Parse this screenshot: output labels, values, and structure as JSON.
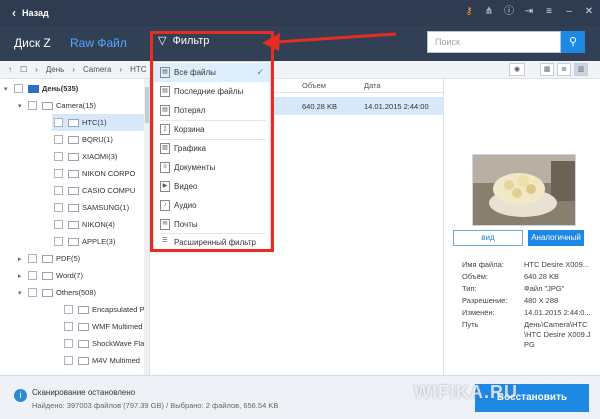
{
  "titlebar": {
    "back_label": "Назад"
  },
  "header": {
    "tabs": [
      {
        "label": "Диск Z"
      },
      {
        "label": "Raw Файл"
      }
    ],
    "filter_label": "Фильтр",
    "search_placeholder": "Поиск"
  },
  "breadcrumb": {
    "items": [
      "День",
      "Camera",
      "HTC"
    ]
  },
  "tree": {
    "root": "День(535)",
    "camera": "Camera(15)",
    "camera_children": [
      "HTC(1)",
      "BQRU(1)",
      "XIAOMI(3)",
      "NIKON CORPO",
      "CASIO COMPU",
      "SAMSUNG(1)",
      "NIKON(4)",
      "APPLE(3)"
    ],
    "pdf": "PDF(5)",
    "word": "Word(7)",
    "others": "Others(508)",
    "others_children": [
      "Encapsulated P",
      "WMF Multimed",
      "ShockWave Fla",
      "M4V Multimed"
    ]
  },
  "filter_menu": {
    "items": [
      "Все файлы",
      "Последние файлы",
      "Потерял",
      "Корзина",
      "Графика",
      "Документы",
      "Видео",
      "Аудио",
      "Почты",
      "Расширенный фильтр"
    ]
  },
  "file_list": {
    "columns": [
      "Объем",
      "Дата"
    ],
    "rows": [
      {
        "size": "640.28 KB",
        "date": "14.01.2015 2:44:00"
      }
    ]
  },
  "preview": {
    "buttons": {
      "view": "вид",
      "analog": "Аналогичный"
    },
    "labels": [
      "Имя файла:",
      "Объём:",
      "Тип:",
      "Разрешение:",
      "Изменён:",
      "Путь"
    ],
    "values": [
      "HTC Desire X009...",
      "640.28 KB",
      "Файл \"JPG\"",
      "480 X 288",
      "14.01.2015 2:44:0...",
      "День\\Camera\\HTC\\HTC Desire X009.JPG"
    ]
  },
  "status": {
    "line1": "Сканирование остановлено",
    "line2": "Найдено: 397003 файлов (797.39 GB) / Выбрано: 2 файлов, 656.54 KB",
    "restore_label": "Восстановить"
  },
  "watermark": "WIFIKA.RU",
  "colors": {
    "accent": "#1e88e5",
    "header": "#324055",
    "annotation_red": "#e52d22"
  }
}
